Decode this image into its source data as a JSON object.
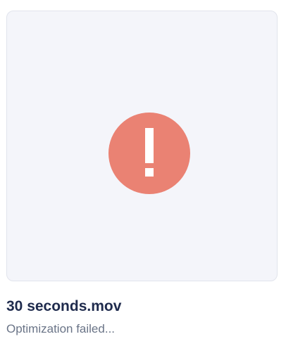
{
  "media": {
    "file_name": "30 seconds.mov",
    "status_text": "Optimization failed...",
    "status_icon": "exclamation-icon"
  },
  "colors": {
    "thumbnail_background": "#f4f5fa",
    "thumbnail_border": "#e1e4ec",
    "error_badge": "#ea8273",
    "file_name_text": "#1f2b4d",
    "status_text": "#6a7487"
  }
}
